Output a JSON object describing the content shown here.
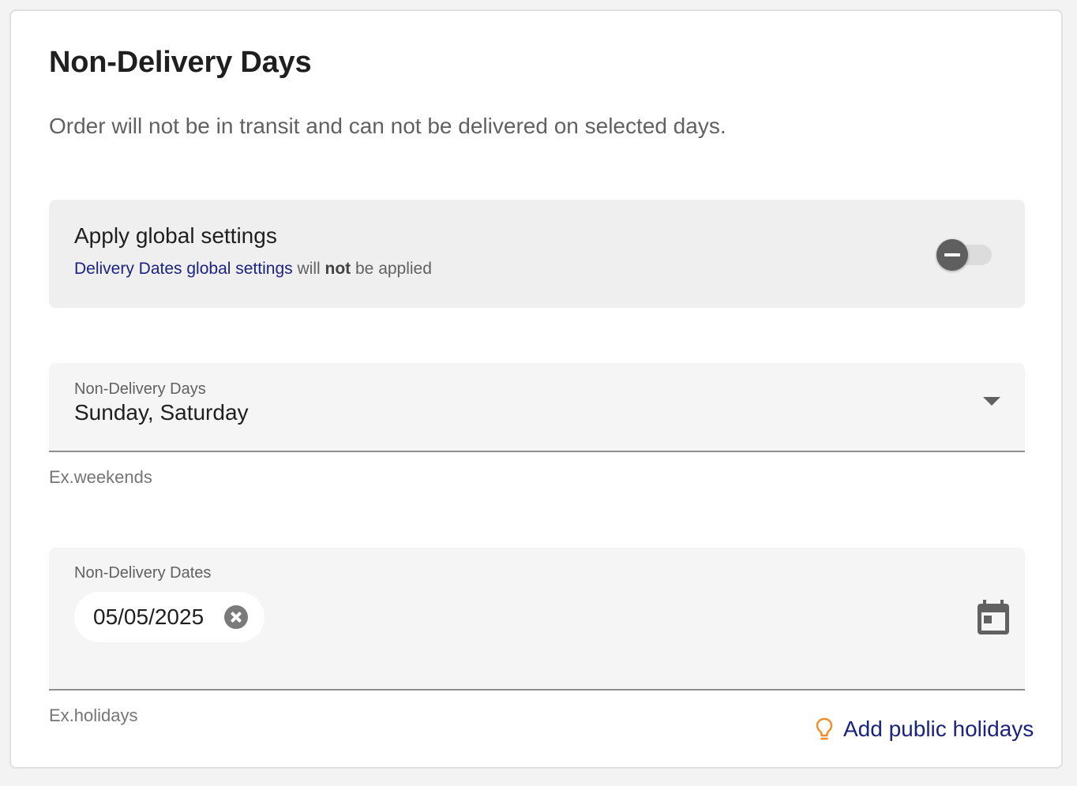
{
  "section": {
    "title": "Non-Delivery Days",
    "description": "Order will not be in transit and can not be delivered on selected days."
  },
  "global_settings": {
    "title": "Apply global settings",
    "link_text": "Delivery Dates global settings",
    "desc_will": "will",
    "desc_not": "not",
    "desc_tail": "be applied",
    "enabled": false
  },
  "non_delivery_days": {
    "label": "Non-Delivery Days",
    "value": "Sunday, Saturday",
    "hint": "Ex.weekends"
  },
  "non_delivery_dates": {
    "label": "Non-Delivery Dates",
    "chips": [
      "05/05/2025"
    ],
    "hint": "Ex.holidays",
    "add_holidays_label": "Add public holidays"
  },
  "icons": {
    "toggle": "toggle-off-icon",
    "dropdown": "dropdown-arrow-icon",
    "chip_remove": "cancel-circle-icon",
    "calendar": "calendar-icon",
    "bulb": "lightbulb-icon"
  },
  "colors": {
    "link": "#1a237e",
    "bulb": "#f28c28",
    "toggle_thumb": "#5f5f5f"
  }
}
